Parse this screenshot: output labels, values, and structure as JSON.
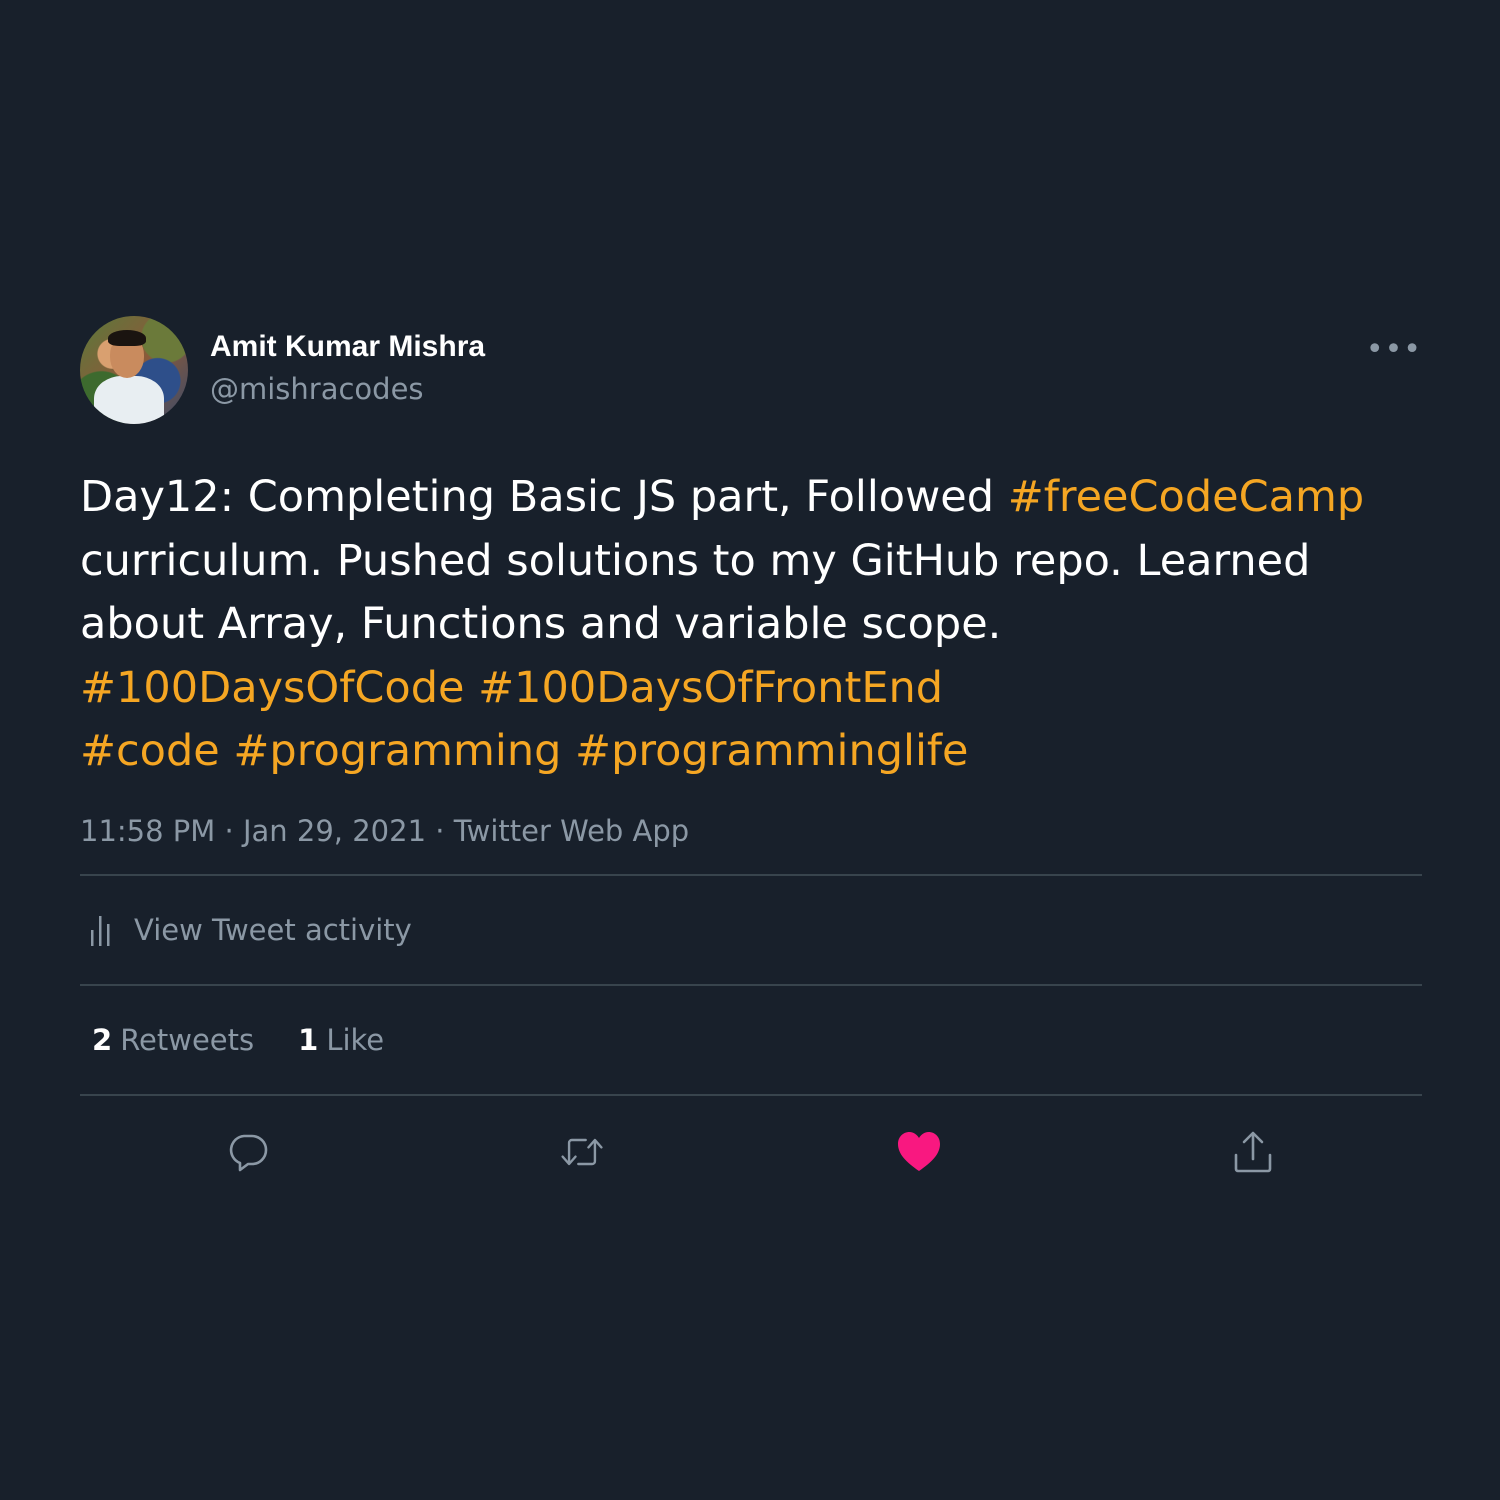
{
  "tweet": {
    "author_name": "Amit Kumar Mishra",
    "author_handle": "@mishracodes",
    "more_label": "•••",
    "body": {
      "line1_text": "Day12: Completing Basic JS part, Followed ",
      "line1_tag": "#freeCodeCamp",
      "line2_text": "curriculum. Pushed solutions to my GitHub repo. Learned",
      "line3_text": "about Array, Functions and variable scope.",
      "tag_100days": "#100DaysOfCode",
      "tag_frontend": "#100DaysOfFrontEnd",
      "tag_code": "#code",
      "tag_programming": "#programming",
      "tag_programminglife": "#programminglife"
    },
    "time": "11:58 PM",
    "date": "Jan 29, 2021",
    "source": "Twitter Web App",
    "separator": "·",
    "activity_label": "View Tweet activity",
    "retweets_count": "2",
    "retweets_label": "Retweets",
    "likes_count": "1",
    "likes_label": "Like"
  },
  "icons": {
    "avatar": "profile-photo",
    "more": "more-dots-icon",
    "activity": "bar-chart-icon",
    "reply": "reply-icon",
    "retweet": "retweet-icon",
    "like": "heart-icon-filled",
    "share": "share-icon"
  },
  "colors": {
    "background": "#18202b",
    "hashtag": "#f5a623",
    "muted": "#8b98a5",
    "like": "#f91880",
    "divider": "#38444d"
  }
}
